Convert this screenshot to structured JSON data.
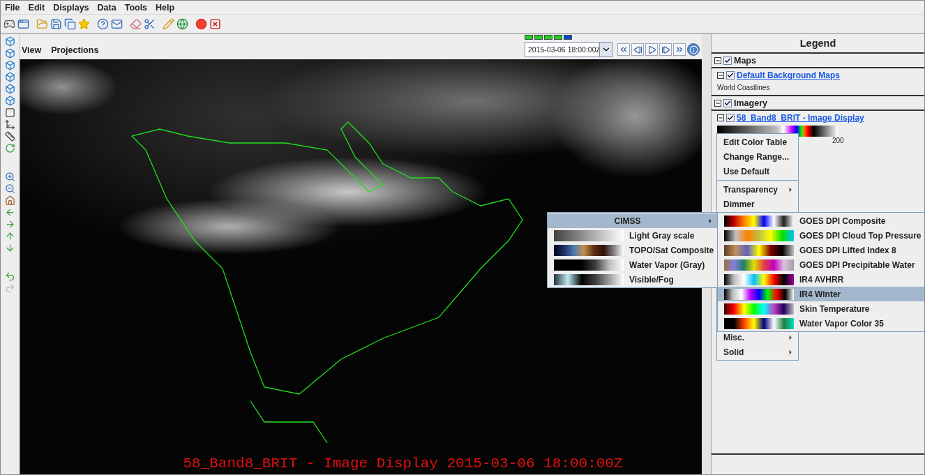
{
  "menubar": [
    "File",
    "Edit",
    "Displays",
    "Data",
    "Tools",
    "Help"
  ],
  "view_menu": [
    "View",
    "Projections"
  ],
  "animation": {
    "frames": [
      {
        "selected": false
      },
      {
        "selected": false
      },
      {
        "selected": false
      },
      {
        "selected": false
      },
      {
        "selected": true
      }
    ],
    "time": "2015-03-06 18:00:00Z"
  },
  "display": {
    "overlay_label": "58_Band8_BRIT - Image Display 2015-03-06 18:00:00Z"
  },
  "legend": {
    "title": "Legend",
    "sections": [
      {
        "label": "Maps",
        "checked": true,
        "expanded": true,
        "layers": [
          {
            "label": "Default Background Maps",
            "checked": true,
            "expanded": true,
            "detail": "World Coastlines"
          }
        ]
      },
      {
        "label": "Imagery",
        "checked": true,
        "expanded": true,
        "layers": [
          {
            "label": "58_Band8_BRIT - Image Display",
            "checked": true,
            "expanded": true,
            "range_label": "200"
          }
        ]
      }
    ]
  },
  "context_menu": [
    {
      "kind": "item",
      "label": "Edit Color Table"
    },
    {
      "kind": "item",
      "label": "Change Range..."
    },
    {
      "kind": "item",
      "label": "Use Default"
    },
    {
      "kind": "separator"
    },
    {
      "kind": "submenu",
      "label": "Transparency"
    },
    {
      "kind": "item",
      "label": "Dimmer"
    },
    {
      "kind": "gap"
    },
    {
      "kind": "submenu",
      "label": "Misc."
    },
    {
      "kind": "submenu",
      "label": "Solid"
    }
  ],
  "color_table_menu": [
    {
      "kind": "submenu",
      "label": "CIMSS",
      "selected": true
    },
    {
      "kind": "table",
      "label": "Light Gray scale",
      "selected": false
    },
    {
      "kind": "table",
      "label": "TOPO/Sat Composite",
      "selected": false
    },
    {
      "kind": "table",
      "label": "Water Vapor (Gray)",
      "selected": false
    },
    {
      "kind": "table",
      "label": "Visible/Fog",
      "selected": false
    }
  ],
  "cimss_menu": [
    {
      "label": "GOES DPI Composite",
      "selected": false
    },
    {
      "label": "GOES DPI Cloud Top Pressure",
      "selected": false
    },
    {
      "label": "GOES DPI Lifted Index 8",
      "selected": false
    },
    {
      "label": "GOES DPI Precipitable Water",
      "selected": false
    },
    {
      "label": "IR4 AVHRR",
      "selected": false
    },
    {
      "label": "IR4 Winter",
      "selected": true
    },
    {
      "label": "Skin Temperature",
      "selected": false
    },
    {
      "label": "Water Vapor Color 35",
      "selected": false
    }
  ]
}
